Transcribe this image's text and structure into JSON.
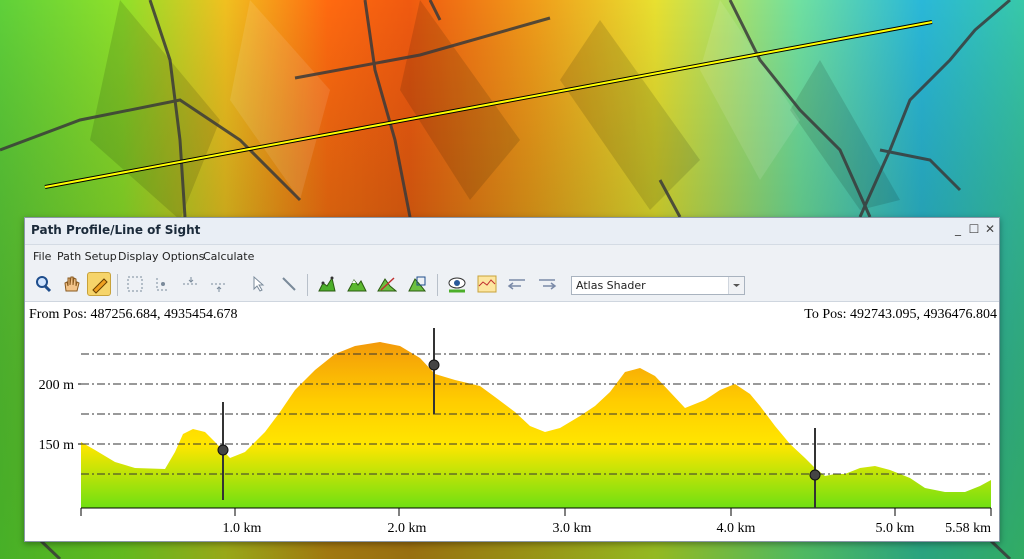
{
  "window": {
    "title": "Path Profile/Line of Sight",
    "controls": {
      "minimize": "_",
      "maximize": "☐",
      "close": "✕"
    }
  },
  "menu": [
    "File",
    "Path Setup",
    "Display Options",
    "Calculate"
  ],
  "toolbar": {
    "icons": [
      "zoom-icon",
      "pan-hand-icon",
      "path-edit-icon",
      "select-box-icon",
      "select-points-icon",
      "distribute-points-icon",
      "spacing-icon",
      "pointer-icon",
      "line-tool-icon",
      "profile-chart-icon",
      "terrain-icon",
      "elevation-fill-icon",
      "3d-view-icon",
      "line-of-sight-icon",
      "profile-line-icon",
      "reverse-left-icon",
      "reverse-right-icon"
    ],
    "shader": "Atlas Shader"
  },
  "profile": {
    "from_label": "From Pos: 487256.684, 4935454.678",
    "to_label": "To Pos: 492743.095, 4936476.804",
    "y_tick_labels": [
      "150 m",
      "200 m"
    ],
    "x_tick_labels": [
      "1.0 km",
      "2.0 km",
      "3.0 km",
      "4.0 km",
      "5.0 km",
      "5.58 km"
    ],
    "colors": {
      "high": "#f39a0a",
      "mid": "#ffe600",
      "low": "#6fe012"
    }
  }
}
